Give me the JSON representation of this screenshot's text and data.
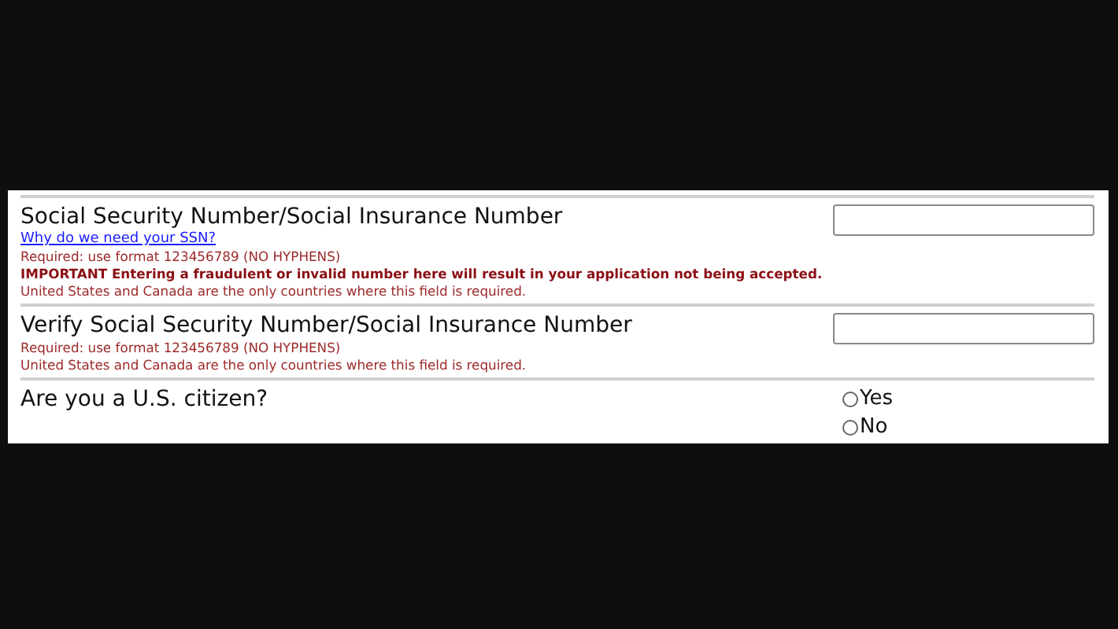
{
  "fields": [
    {
      "kind": "text",
      "label": "Social Security Number/Social Insurance Number",
      "link": "Why do we need your SSN?",
      "notes": [
        {
          "text": "Required: use format 123456789 (NO HYPHENS)",
          "strong": false
        },
        {
          "text": "IMPORTANT Entering a fraudulent or invalid number here will result in your application not being accepted.",
          "strong": true
        },
        {
          "text": "United States and Canada are the only countries where this field is required.",
          "strong": false
        }
      ]
    },
    {
      "kind": "text",
      "label": "Verify Social Security Number/Social Insurance Number",
      "notes": [
        {
          "text": "Required: use format 123456789 (NO HYPHENS)",
          "strong": false
        },
        {
          "text": "United States and Canada are the only countries where this field is required.",
          "strong": false
        }
      ]
    },
    {
      "kind": "radio",
      "label": "Are you a U.S. citizen?",
      "options": [
        {
          "label": "Yes",
          "selected": false
        },
        {
          "label": "No",
          "selected": false
        }
      ]
    }
  ]
}
